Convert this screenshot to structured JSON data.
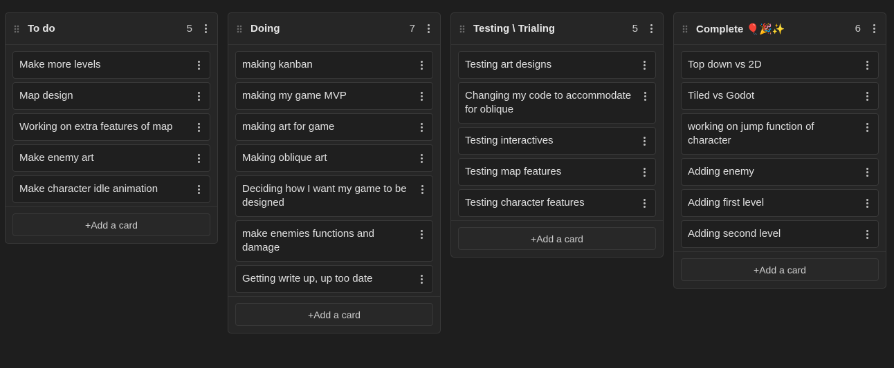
{
  "columns": [
    {
      "title": "To do",
      "count": "5",
      "cards": [
        "Make more levels",
        "Map design",
        "Working on extra features of map",
        "Make enemy art",
        "Make character idle animation"
      ],
      "add_label": "+Add a card"
    },
    {
      "title": "Doing",
      "count": "7",
      "cards": [
        "making kanban",
        "making my game MVP",
        "making art for game",
        "Making oblique art",
        "Deciding how I want my game to be designed",
        "make enemies functions and damage",
        "Getting write up, up too date"
      ],
      "add_label": "+Add a card"
    },
    {
      "title": "Testing \\ Trialing",
      "count": "5",
      "cards": [
        "Testing art designs",
        "Changing my code to accommodate for oblique",
        "Testing interactives",
        "Testing map features",
        "Testing character features"
      ],
      "add_label": "+Add a card"
    },
    {
      "title": "Complete 🎈🎉✨",
      "count": "6",
      "cards": [
        "Top down vs 2D",
        "Tiled vs Godot",
        "working on jump function of character",
        "Adding enemy",
        "Adding first level",
        "Adding second level"
      ],
      "add_label": "+Add a card"
    }
  ],
  "colors": {
    "background": "#1e1e1e",
    "column": "#262626",
    "card": "#1f1f1f",
    "border": "#383838"
  }
}
